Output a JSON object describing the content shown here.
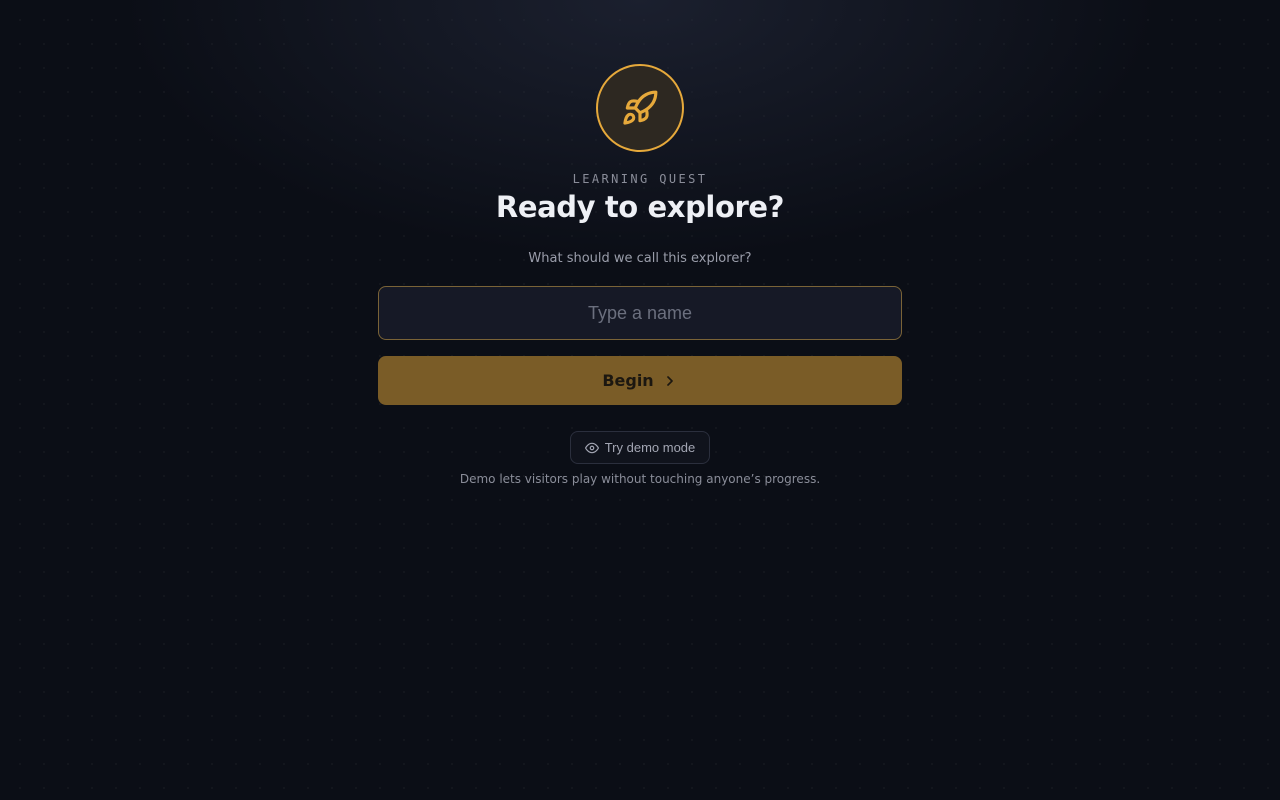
{
  "header": {
    "badge_icon": "rocket-icon",
    "eyebrow": "LEARNING QUEST",
    "title": "Ready to explore?"
  },
  "form": {
    "prompt": "What should we call this explorer?",
    "name_input": {
      "value": "",
      "placeholder": "Type a name"
    },
    "begin_label": "Begin",
    "begin_icon": "chevron-right-icon"
  },
  "demo": {
    "button_label": "Try demo mode",
    "button_icon": "eye-icon",
    "note": "Demo lets visitors play without touching anyone’s progress."
  },
  "colors": {
    "accent": "#e6a93b",
    "begin_bg": "#7a5c27",
    "background": "#0b0e16",
    "input_bg": "#161926"
  }
}
